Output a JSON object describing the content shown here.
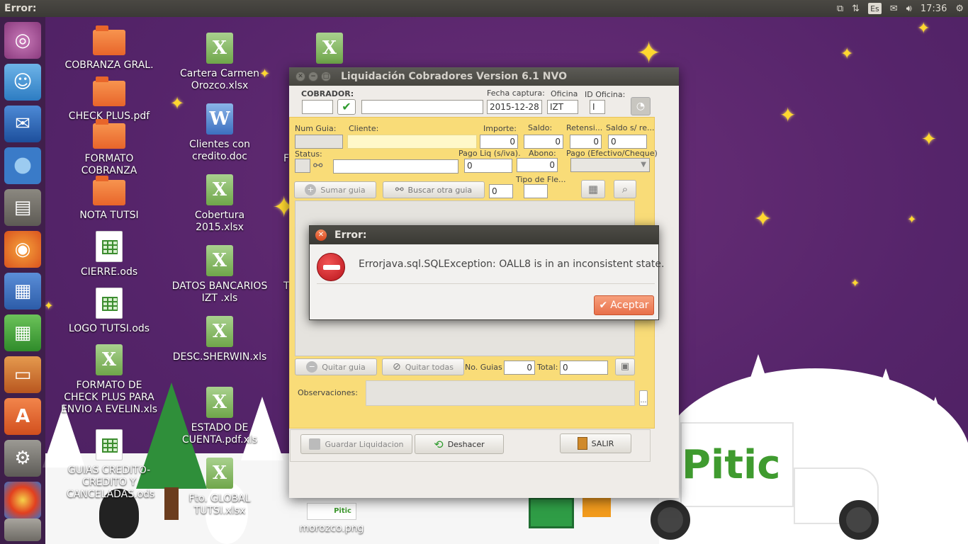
{
  "top_panel": {
    "title": "Error:",
    "time": "17:36",
    "keyboard": "Es",
    "icons": [
      "dropbox-icon",
      "network-icon",
      "keyboard-icon",
      "mail-icon",
      "volume-icon",
      "power-gear-icon"
    ]
  },
  "launcher": {
    "items": [
      "ubuntu-dash-icon",
      "empathy-icon",
      "thunderbird-icon",
      "chromium-icon",
      "files-icon",
      "firefox-icon",
      "writer-icon",
      "calc-icon",
      "impress-icon",
      "software-center-icon",
      "system-settings-icon",
      "image-icon",
      "trash-icon"
    ]
  },
  "desktop": {
    "col1": [
      {
        "label": "COBRANZA GRAL.",
        "type": "folder"
      },
      {
        "label": "CHECK PLUS.pdf",
        "type": "folder"
      },
      {
        "label": "FORMATO COBRANZA",
        "type": "folder"
      },
      {
        "label": "NOTA TUTSI",
        "type": "folder"
      },
      {
        "label": "CIERRE.ods",
        "type": "ods"
      },
      {
        "label": "LOGO TUTSI.ods",
        "type": "ods"
      },
      {
        "label": "FORMATO DE CHECK PLUS PARA ENVIO A EVELIN.xls",
        "type": "xls"
      },
      {
        "label": "GUIAS CREDITO-CREDITO Y CANCELADAS.ods",
        "type": "ods"
      }
    ],
    "col2": [
      {
        "label": "Cartera Carmen Orozco.xlsx",
        "type": "xls"
      },
      {
        "label": "Clientes con credito.doc",
        "type": "doc"
      },
      {
        "label": "Cobertura 2015.xlsx",
        "type": "xls"
      },
      {
        "label": "DATOS BANCARIOS IZT .xls",
        "type": "xls"
      },
      {
        "label": "DESC.SHERWIN.xls",
        "type": "xls"
      },
      {
        "label": "ESTADO DE CUENTA.pdf.xls",
        "type": "xls"
      },
      {
        "label": "Fto. GLOBAL TUTSI.xlsx",
        "type": "xls"
      }
    ],
    "col3_partial": [
      "F",
      "T"
    ],
    "png_icon": {
      "label": "morozco.png",
      "thumb_text": "Pitic"
    },
    "truck_logo": "Pitic"
  },
  "window": {
    "title": "Liquidación Cobradores Version 6.1 NVO",
    "labels": {
      "cobrador": "COBRADOR:",
      "fecha_captura": "Fecha captura:",
      "oficina": "Oficina",
      "id_oficina": "ID Oficina:",
      "num_guia": "Num Guia:",
      "cliente": "Cliente:",
      "importe": "Importe:",
      "saldo": "Saldo:",
      "retension": "Retensi...",
      "saldo_sre": "Saldo s/ re...",
      "status": "Status:",
      "pago_liq": "Pago Liq (s/iva).",
      "abono": "Abono:",
      "pago_tipo": "Pago (Efectivo/Cheque)",
      "tipo_fle": "Tipo de Fle...",
      "no_guias": "No. Guias",
      "total": "Total:",
      "observaciones": "Observaciones:"
    },
    "values": {
      "fecha": "2015-12-28",
      "oficina": "IZT",
      "id_oficina": "I",
      "importe": "0",
      "saldo": "0",
      "retension": "0",
      "saldo_sre": "0",
      "pago_liq": "0",
      "abono": "0",
      "buscar_count": "0",
      "no_guias": "0",
      "total": "0"
    },
    "buttons": {
      "sumar_guia": "Sumar guia",
      "buscar_otra": "Buscar otra guia",
      "quitar_guia": "Quitar guia",
      "quitar_todas": "Quitar todas",
      "guardar": "Guardar Liquidacion",
      "deshacer": "Deshacer",
      "salir": "SALIR"
    }
  },
  "dialog": {
    "title": "Error:",
    "message": "Errorjava.sql.SQLException: OALL8 is in an inconsistent state.",
    "ok_label": "Aceptar"
  }
}
